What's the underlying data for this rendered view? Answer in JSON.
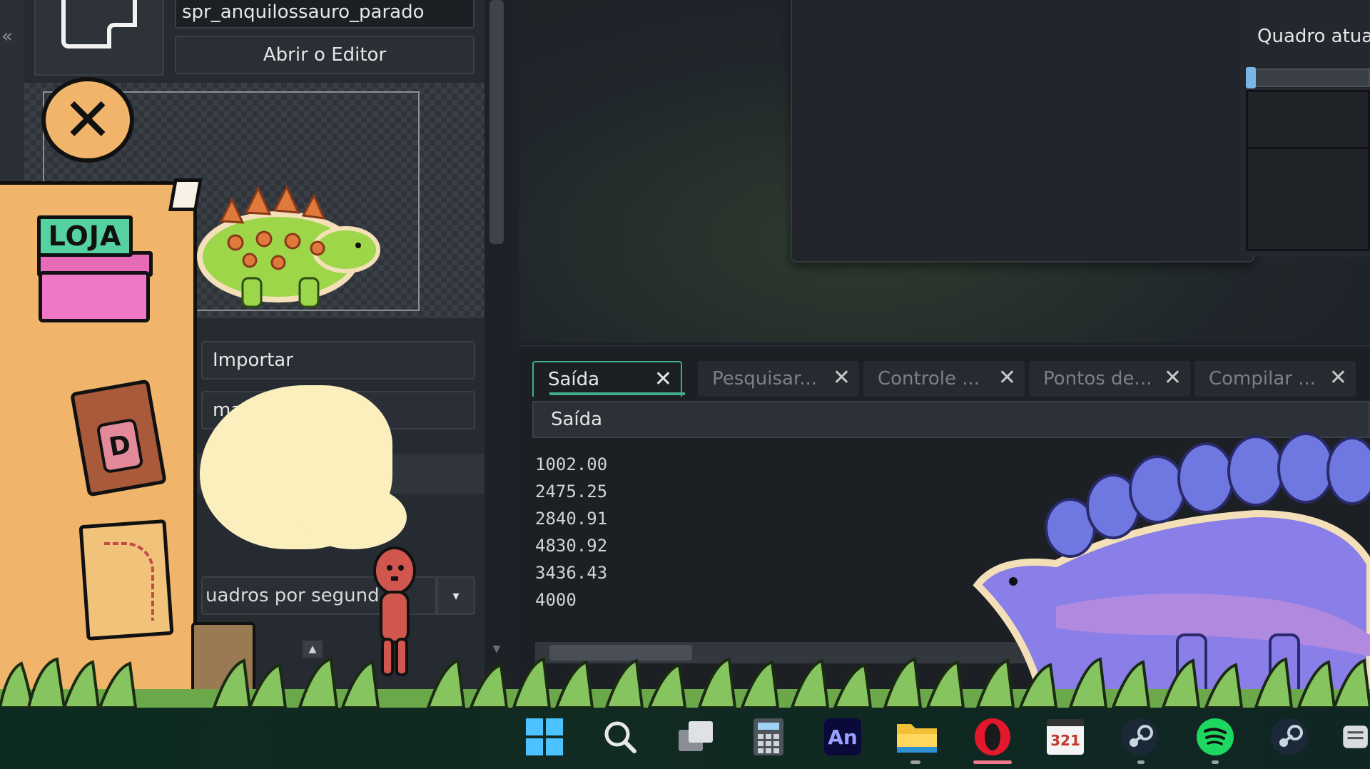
{
  "left_panel": {
    "collapse_glyph": "«",
    "sprite_name": "spr_anquilossauro_parado",
    "open_editor_label": "Abrir o Editor",
    "import_label": "Importar",
    "image_label": "magem",
    "fps_label": "uadros por segund",
    "fps_arrow": "▾",
    "spin_up": "▲",
    "scroll_down": "▼"
  },
  "right_panel": {
    "current_frame_label": "Quadro atual"
  },
  "output": {
    "tabs": [
      {
        "label": "Saída",
        "active": true
      },
      {
        "label": "Pesquisar...",
        "active": false
      },
      {
        "label": "Controle ...",
        "active": false
      },
      {
        "label": "Pontos de...",
        "active": false
      },
      {
        "label": "Compilar ...",
        "active": false
      }
    ],
    "close_glyph": "✕",
    "header": "Saída",
    "lines": [
      "1002.00",
      "2475.25",
      "2840.91",
      "4830.92",
      "3436.43",
      "4000"
    ]
  },
  "game_overlay": {
    "close_glyph": "✕",
    "shop_sign": "LOJA",
    "book_letter": "D"
  },
  "taskbar": {
    "icons": [
      "windows-start-icon",
      "search-icon",
      "task-view-icon",
      "calculator-icon",
      "animate-icon",
      "file-explorer-icon",
      "opera-icon",
      "media-player-icon",
      "steam-icon",
      "spotify-icon",
      "steam-icon-2",
      "app-icon"
    ],
    "animate_label": "An",
    "media_label": "321"
  }
}
